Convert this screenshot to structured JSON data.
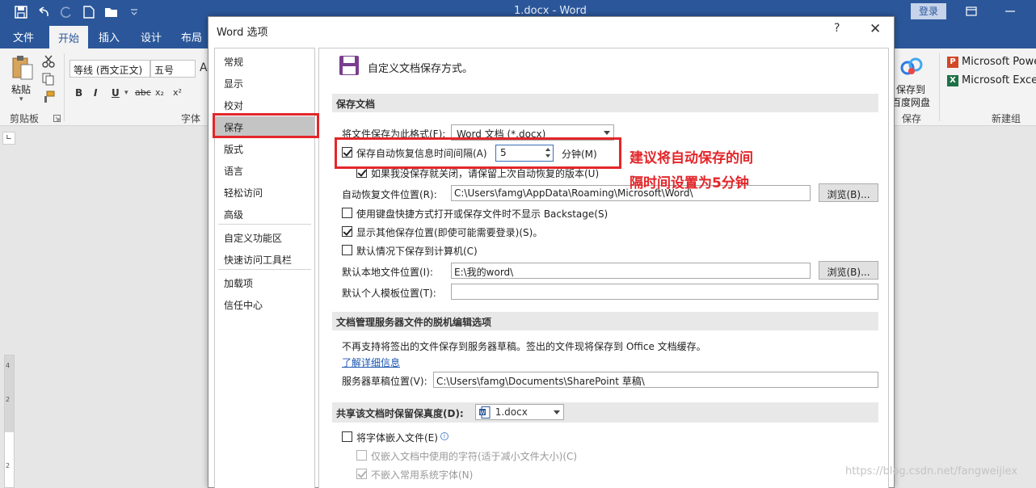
{
  "window": {
    "title": "1.docx  -  Word",
    "login_label": "登录",
    "accent": "#2b579a"
  },
  "ribbon_tabs": [
    "文件",
    "开始",
    "插入",
    "设计",
    "布局"
  ],
  "ribbon": {
    "paste_label": "粘贴",
    "font_name": "等线 (西文正文)",
    "font_size": "五号",
    "font_grow": "A",
    "bold": "B",
    "italic": "I",
    "underline": "U",
    "strikethrough": "abc",
    "subscript": "x₂",
    "superscript": "x²",
    "clipboard_group": "剪贴板",
    "font_group": "字体",
    "baidu_save_label_line1": "保存到",
    "baidu_save_label_line2": "百度网盘",
    "save_group": "保存",
    "new_group": "新建组",
    "apps": [
      "Microsoft PowerPoint",
      "Microsoft Excel"
    ]
  },
  "ruler_numbers": [
    "4",
    "2",
    "2"
  ],
  "dialog": {
    "title": "Word 选项",
    "help": "?",
    "close": "✕",
    "nav": [
      "常规",
      "显示",
      "校对",
      "保存",
      "版式",
      "语言",
      "轻松访问",
      "高级",
      "自定义功能区",
      "快速访问工具栏",
      "加载项",
      "信任中心"
    ],
    "nav_selected": "保存",
    "header": "自定义文档保存方式。",
    "save_section": {
      "title": "保存文档",
      "format_label": "将文件保存为此格式(F):",
      "format_value": "Word 文档 (*.docx)",
      "autorecover_label": "保存自动恢复信息时间间隔(A)",
      "autorecover_checked": true,
      "autorecover_minutes": "5",
      "minutes_label": "分钟(M)",
      "keep_last_label": "如果我没保存就关闭，请保留上次自动恢复的版本(U)",
      "keep_last_checked": true,
      "autorecover_path_label": "自动恢复文件位置(R):",
      "autorecover_path": "C:\\Users\\famg\\AppData\\Roaming\\Microsoft\\Word\\",
      "browse_label": "浏览(B)...",
      "backstage_label": "使用键盘快捷方式打开或保存文件时不显示 Backstage(S)",
      "backstage_checked": false,
      "show_more_label": "显示其他保存位置(即使可能需要登录)(S)。",
      "show_more_checked": true,
      "default_computer_label": "默认情况下保存到计算机(C)",
      "default_computer_checked": false,
      "local_path_label": "默认本地文件位置(I):",
      "local_path": "E:\\我的word\\",
      "browse2_label": "浏览(B)...",
      "template_label": "默认个人模板位置(T):",
      "template_path": ""
    },
    "offline_section": {
      "title": "文档管理服务器文件的脱机编辑选项",
      "notice": "不再支持将签出的文件保存到服务器草稿。签出的文件现将保存到 Office 文档缓存。",
      "learn_more": "了解详细信息",
      "drafts_label": "服务器草稿位置(V):",
      "drafts_path": "C:\\Users\\famg\\Documents\\SharePoint 草稿\\"
    },
    "fidelity_section": {
      "title": "共享该文档时保留保真度(D):",
      "doc_value": "1.docx",
      "embed_fonts_label": "将字体嵌入文件(E)",
      "embed_fonts_checked": false,
      "embed_used_label": "仅嵌入文档中使用的字符(适于减小文件大小)(C)",
      "embed_used_checked": false,
      "no_common_label": "不嵌入常用系统字体(N)",
      "no_common_checked": true
    }
  },
  "annotation": {
    "line1": "建议将自动保存的间",
    "line2": "隔时间设置为5分钟",
    "color": "#e3262a"
  },
  "watermark": "https://blog.csdn.net/fangweijiex"
}
